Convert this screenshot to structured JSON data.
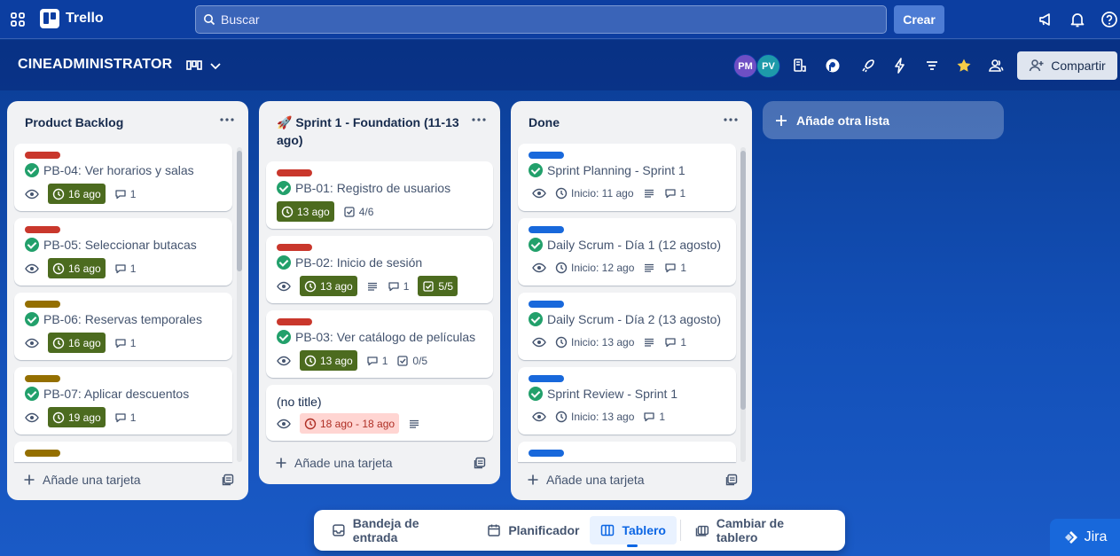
{
  "app": {
    "name": "Trello"
  },
  "search": {
    "placeholder": "Buscar"
  },
  "topbar": {
    "create_label": "Crear"
  },
  "board": {
    "title": "CINEADMINISTRATOR",
    "members": [
      {
        "initials": "PM",
        "color": "#6e4fc4"
      },
      {
        "initials": "PV",
        "color": "#1d9aaa"
      }
    ],
    "share_label": "Compartir",
    "starred": true
  },
  "lists": [
    {
      "title": "Product Backlog",
      "add_card_label": "Añade una tarjeta",
      "cards": [
        {
          "title": "PB-04: Ver horarios y salas",
          "label_color": "#c9372c",
          "due": "16 ago",
          "comments": "1"
        },
        {
          "title": "PB-05: Seleccionar butacas",
          "label_color": "#c9372c",
          "due": "16 ago",
          "comments": "1"
        },
        {
          "title": "PB-06: Reservas temporales",
          "label_color": "#946f00",
          "due": "16 ago",
          "comments": "1"
        },
        {
          "title": "PB-07: Aplicar descuentos",
          "label_color": "#946f00",
          "due": "19 ago",
          "comments": "1"
        }
      ]
    },
    {
      "title": "🚀 Sprint 1 - Foundation (11-13 ago)",
      "add_card_label": "Añade una tarjeta",
      "cards": [
        {
          "title": "PB-01: Registro de usuarios",
          "label_color": "#c9372c",
          "due": "13 ago",
          "checklist": "4/6"
        },
        {
          "title": "PB-02: Inicio de sesión",
          "label_color": "#c9372c",
          "due": "13 ago",
          "comments": "1",
          "checklist": "5/5"
        },
        {
          "title": "PB-03: Ver catálogo de películas",
          "label_color": "#c9372c",
          "due": "13 ago",
          "comments": "1",
          "checklist": "0/5"
        },
        {
          "title": "(no title)",
          "due": "18 ago - 18 ago"
        }
      ]
    },
    {
      "title": "Done",
      "add_card_label": "Añade una tarjeta",
      "cards": [
        {
          "title": "Sprint Planning - Sprint 1",
          "label_color": "#1868db",
          "start": "Inicio: 11 ago",
          "comments": "1"
        },
        {
          "title": "Daily Scrum - Día 1 (12 agosto)",
          "label_color": "#1868db",
          "start": "Inicio: 12 ago",
          "comments": "1"
        },
        {
          "title": "Daily Scrum - Día 2 (13 agosto)",
          "label_color": "#1868db",
          "start": "Inicio: 13 ago",
          "comments": "1"
        },
        {
          "title": "Sprint Review - Sprint 1",
          "label_color": "#1868db",
          "start": "Inicio: 13 ago",
          "comments": "1"
        }
      ]
    }
  ],
  "add_list_label": "Añade otra lista",
  "bottom_nav": {
    "inbox": "Bandeja de entrada",
    "planner": "Planificador",
    "board": "Tablero",
    "switch": "Cambiar de tablero"
  },
  "jira_label": "Jira"
}
